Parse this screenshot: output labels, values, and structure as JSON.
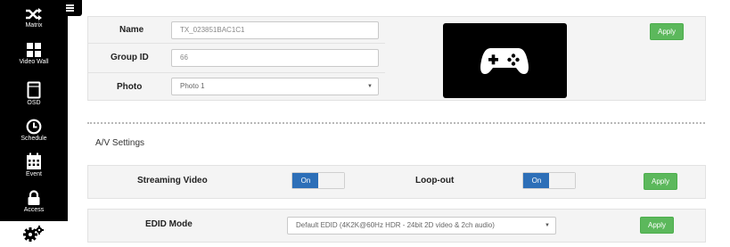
{
  "sidebar": {
    "items": [
      {
        "label": "Matrix",
        "icon": "shuffle-icon"
      },
      {
        "label": "Video Wall",
        "icon": "grid-icon"
      },
      {
        "label": "OSD",
        "icon": "monitor-icon"
      },
      {
        "label": "Schedule",
        "icon": "clock-icon"
      },
      {
        "label": "Event",
        "icon": "calendar-icon"
      },
      {
        "label": "Access",
        "icon": "lock-icon"
      },
      {
        "label": "",
        "icon": "gears-icon",
        "active": true
      }
    ]
  },
  "device": {
    "name_label": "Name",
    "name_value": "TX_023851BAC1C1",
    "group_label": "Group ID",
    "group_value": "66",
    "photo_label": "Photo",
    "photo_value": "Photo 1",
    "preview_icon": "gamepad-icon",
    "apply_label": "Apply"
  },
  "av": {
    "section_title": "A/V Settings",
    "streaming_label": "Streaming Video",
    "streaming_state": "On",
    "loopout_label": "Loop-out",
    "loopout_state": "On",
    "apply_label": "Apply",
    "edid_label": "EDID Mode",
    "edid_value": "Default EDID (4K2K@60Hz HDR - 24bit 2D video & 2ch audio)",
    "edid_apply_label": "Apply"
  },
  "colors": {
    "accent": "#2d6fb8",
    "apply": "#5cb85c",
    "sidebar": "#000000"
  }
}
